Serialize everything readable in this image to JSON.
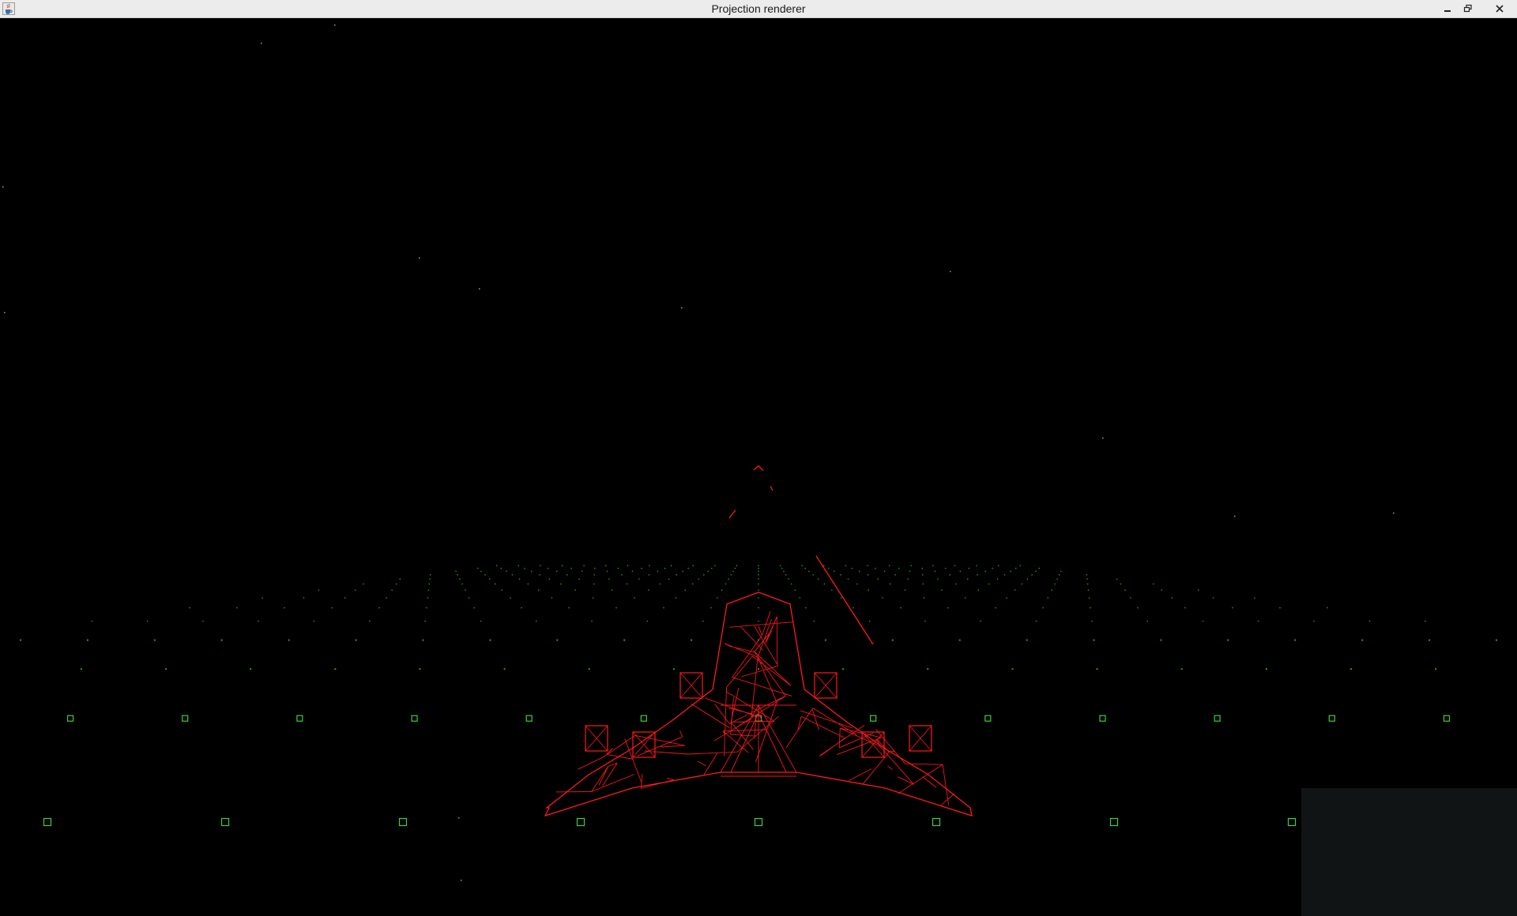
{
  "window": {
    "title": "Projection renderer",
    "icon": "java-cup-icon",
    "controls": [
      "minimize-icon",
      "restore-icon",
      "close-icon"
    ]
  },
  "scene": {
    "background_color": "#000000",
    "grid_color": "#3ccf3c",
    "model_color": "#ff1a1a",
    "panel_color": "#111414",
    "model": "wireframe-spaceship"
  }
}
